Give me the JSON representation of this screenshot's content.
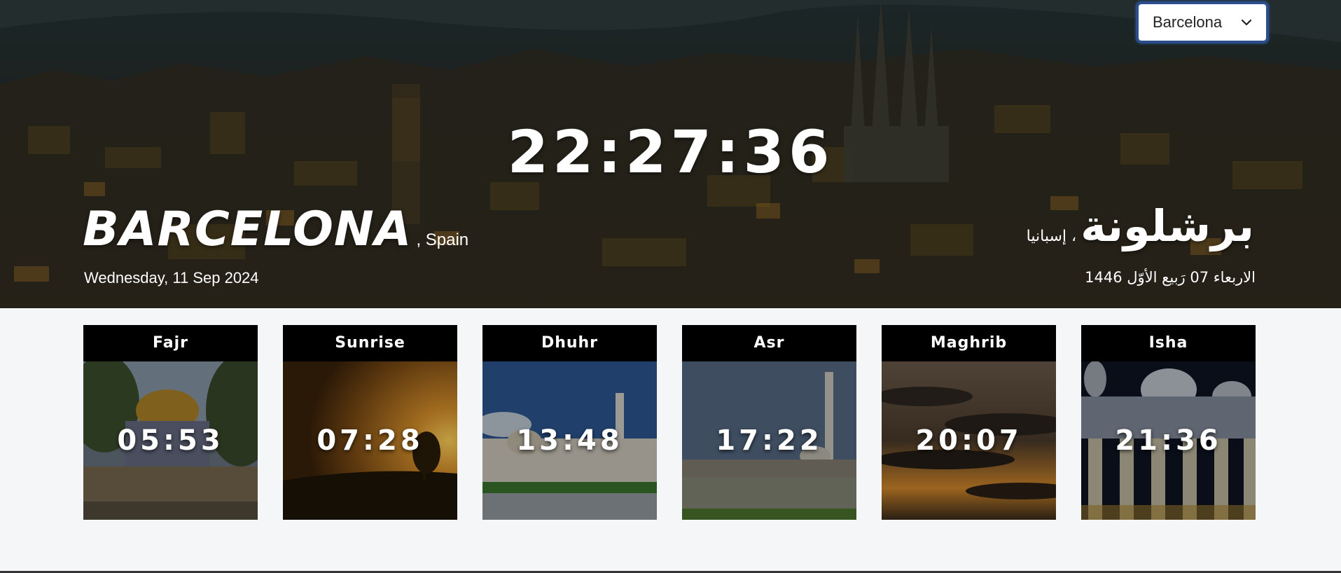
{
  "selector": {
    "selected": "Barcelona"
  },
  "clock": "22:27:36",
  "location": {
    "city": "BARCELONA",
    "country": ", Spain",
    "date": "Wednesday, 11 Sep 2024",
    "city_ar": "برشلونة",
    "country_ar": "، إسبانيا",
    "date_ar": "الاربعاء 07 رَبيع الأوّل 1446"
  },
  "prayers": [
    {
      "name": "Fajr",
      "time": "05:53"
    },
    {
      "name": "Sunrise",
      "time": "07:28"
    },
    {
      "name": "Dhuhr",
      "time": "13:48"
    },
    {
      "name": "Asr",
      "time": "17:22"
    },
    {
      "name": "Maghrib",
      "time": "20:07"
    },
    {
      "name": "Isha",
      "time": "21:36"
    }
  ],
  "icons": {
    "dropdown": "chevron-down-icon"
  }
}
